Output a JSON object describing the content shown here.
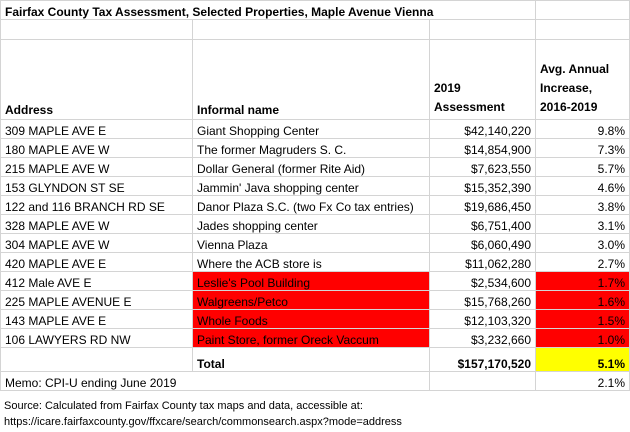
{
  "title": "Fairfax County Tax Assessment, Selected Properties, Maple Avenue Vienna",
  "headers": {
    "address": "Address",
    "informal_name": "Informal name",
    "assessment": "2019 Assessment",
    "increase": "Avg. Annual Increase, 2016-2019"
  },
  "rows": [
    {
      "address": "309 MAPLE AVE E",
      "name": "Giant Shopping Center",
      "assessment": "$42,140,220",
      "increase": "9.8%",
      "highlight": false
    },
    {
      "address": "180 MAPLE AVE W",
      "name": "The former Magruders S. C.",
      "assessment": "$14,854,900",
      "increase": "7.3%",
      "highlight": false
    },
    {
      "address": "215 MAPLE AVE W",
      "name": "Dollar General (former Rite Aid)",
      "assessment": "$7,623,550",
      "increase": "5.7%",
      "highlight": false
    },
    {
      "address": "153 GLYNDON ST SE",
      "name": "Jammin' Java shopping center",
      "assessment": "$15,352,390",
      "increase": "4.6%",
      "highlight": false
    },
    {
      "address": "122 and 116 BRANCH RD SE",
      "name": "Danor Plaza S.C. (two Fx Co tax entries)",
      "assessment": "$19,686,450",
      "increase": "3.8%",
      "highlight": false
    },
    {
      "address": "328 MAPLE AVE W",
      "name": "Jades shopping center",
      "assessment": "$6,751,400",
      "increase": "3.1%",
      "highlight": false
    },
    {
      "address": "304 MAPLE AVE W",
      "name": "Vienna Plaza",
      "assessment": "$6,060,490",
      "increase": "3.0%",
      "highlight": false
    },
    {
      "address": "420 MAPLE AVE E",
      "name": "Where the ACB store is",
      "assessment": "$11,062,280",
      "increase": "2.7%",
      "highlight": false
    },
    {
      "address": "412 Male AVE E",
      "name": "Leslie's Pool Building",
      "assessment": "$2,534,600",
      "increase": "1.7%",
      "highlight": true
    },
    {
      "address": "225 MAPLE AVENUE E",
      "name": "Walgreens/Petco",
      "assessment": "$15,768,260",
      "increase": "1.6%",
      "highlight": true
    },
    {
      "address": "143 MAPLE AVE E",
      "name": "Whole Foods",
      "assessment": "$12,103,320",
      "increase": "1.5%",
      "highlight": true
    },
    {
      "address": "106 LAWYERS RD NW",
      "name": "Paint Store, former Oreck Vaccum",
      "assessment": "$3,232,660",
      "increase": "1.0%",
      "highlight": true
    }
  ],
  "total": {
    "label": "Total",
    "assessment": "$157,170,520",
    "increase": "5.1%"
  },
  "memo": {
    "label": "Memo:  CPI-U ending June 2019",
    "value": "2.1%"
  },
  "source": {
    "line1": "Source:  Calculated from Fairfax County tax maps and data, accessible at:",
    "line2": "https://icare.fairfaxcounty.gov/ffxcare/search/commonsearch.aspx?mode=address"
  },
  "colors": {
    "highlight_red": "#ff0000",
    "total_yellow": "#ffff00",
    "gridline": "#d4d4d4"
  }
}
